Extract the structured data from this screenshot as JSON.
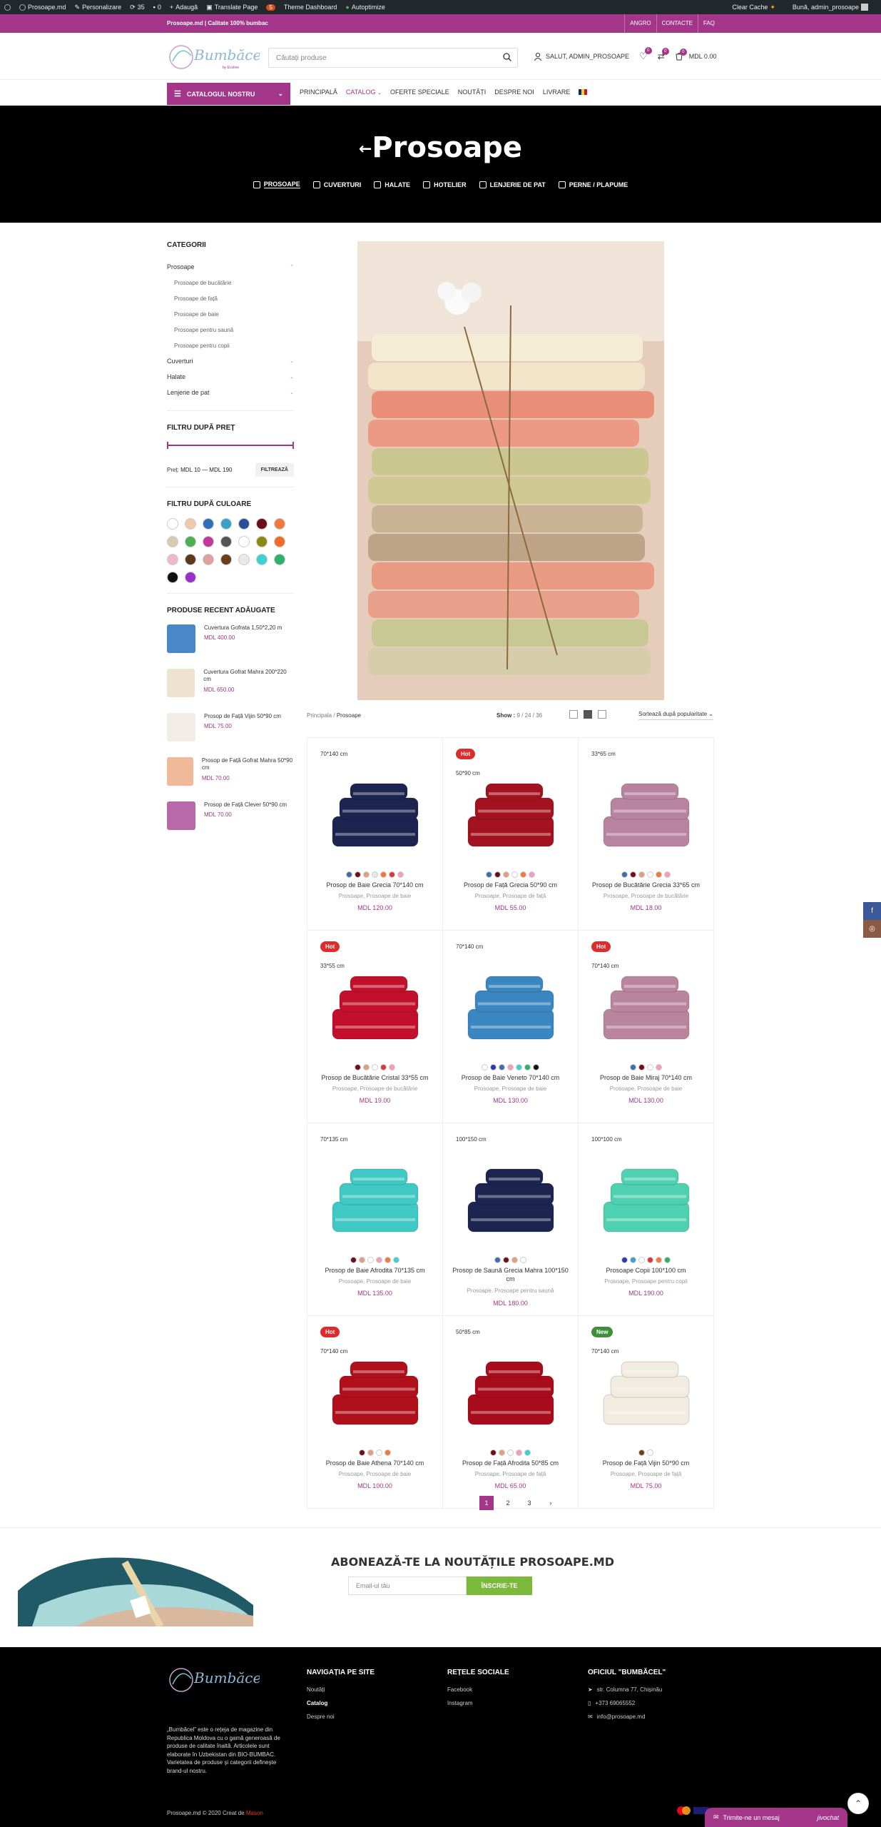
{
  "adminbar": {
    "site": "Prosoape.md",
    "customize": "Personalizare",
    "updates": "35",
    "comments": "0",
    "add": "Adaugă",
    "translate": "Translate Page",
    "badge": "5",
    "theme": "Theme Dashboard",
    "autoptimize": "Autoptimize",
    "clear_cache": "Clear Cache",
    "greeting": "Bună, admin_prosoape"
  },
  "topbar": {
    "text": "Prosoape.md | Calitate 100% bumbac",
    "links": [
      "ANGRO",
      "CONTACTE",
      "FAQ"
    ]
  },
  "header": {
    "logo_text": "Bumbăcel",
    "logo_tag": "by Ecoline",
    "search_placeholder": "Căutați produse",
    "account": "SALUT, ADMIN_PROSOAPE",
    "wishlist_count": "0",
    "compare_count": "0",
    "cart_count": "0",
    "cart_total": "MDL 0.00"
  },
  "nav": {
    "catalog_button": "CATALOGUL NOSTRU",
    "items": [
      "PRINCIPALĂ",
      "CATALOG",
      "OFERTE SPECIALE",
      "NOUTĂȚI",
      "DESPRE NOI",
      "LIVRARE"
    ]
  },
  "hero": {
    "title": "Prosoape",
    "cats": [
      "PROSOAPE",
      "CUVERTURI",
      "HALATE",
      "HOTELIER",
      "LENJERIE DE PAT",
      "PERNE / PLAPUME"
    ]
  },
  "sidebar": {
    "categories_title": "CATEGORII",
    "categories": [
      {
        "label": "Prosoape",
        "sub": false
      },
      {
        "label": "Prosoape de bucătărie",
        "sub": true
      },
      {
        "label": "Prosoape de față",
        "sub": true
      },
      {
        "label": "Prosoape de baie",
        "sub": true
      },
      {
        "label": "Prosoape pentru saună",
        "sub": true
      },
      {
        "label": "Prosoape pentru copii",
        "sub": true
      },
      {
        "label": "Cuverturi",
        "sub": false
      },
      {
        "label": "Halate",
        "sub": false
      },
      {
        "label": "Lenjerie de pat",
        "sub": false
      }
    ],
    "price_title": "FILTRU DUPĂ PREȚ",
    "price_label": "Preț:",
    "price_range": "MDL 10 — MDL 190",
    "price_button": "FILTREAZĂ",
    "color_title": "FILTRU DUPĂ CULOARE",
    "colors": [
      "#ffffff",
      "#f2c9a8",
      "#2f6fb5",
      "#3aa0c8",
      "#2a4e9a",
      "#6b0f1a",
      "#f07a3c",
      "#d8cbb0",
      "#4caf50",
      "#c0399a",
      "#555555",
      "#ffffff",
      "#8a8a14",
      "#f06a2a",
      "#f0b8c8",
      "#5a3a1a",
      "#e0a0a0",
      "#6b3f1a",
      "#e8e8e8",
      "#3fd0d0",
      "#2fb06a",
      "#111111",
      "#9b30c8"
    ],
    "recent_title": "PRODUSE RECENT ADĂUGATE",
    "recent": [
      {
        "name": "Cuvertura Gofrata 1,50*2,20 m",
        "price": "MDL 400.00",
        "color": "#4a86c8"
      },
      {
        "name": "Cuvertura Gofrat Mahra 200*220 cm",
        "price": "MDL 650.00",
        "color": "#efe3cf"
      },
      {
        "name": "Prosop de Față Vijin 50*90 cm",
        "price": "MDL 75.00",
        "color": "#f2ede6"
      },
      {
        "name": "Prosop de Față Gofrat Mahra 50*90 cm",
        "price": "MDL 70.00",
        "color": "#efb99a"
      },
      {
        "name": "Prosop de Față Clever 50*90 cm",
        "price": "MDL 70.00",
        "color": "#b86aa8"
      }
    ]
  },
  "toolbar": {
    "breadcrumb_home": "Principala",
    "breadcrumb_sep": "/",
    "breadcrumb_current": "Prosoape",
    "show_label": "Show :",
    "show_options": [
      "9",
      "24",
      "36"
    ],
    "sort": "Sortează după popularitate"
  },
  "products": [
    {
      "badge": "",
      "size": "70*140 cm",
      "title": "Prosop de Baie Grecia 70*140 cm",
      "cats": "Prosoape, Prosoape de baie",
      "price": "MDL 120.00",
      "color": "#1c2450",
      "colors": [
        "#3a6fa8",
        "#6b0f1a",
        "#e0a080",
        "#e8e8e8",
        "#f07a3c",
        "#d63a3a",
        "#f0a0b8"
      ]
    },
    {
      "badge": "Hot",
      "size": "50*90 cm",
      "title": "Prosop de Față Grecia 50*90 cm",
      "cats": "Prosoape, Prosoape de față",
      "price": "MDL 55.00",
      "color": "#a3131f",
      "colors": [
        "#3a6fa8",
        "#6b0f1a",
        "#e0a080",
        "#ffffff",
        "#f07a3c",
        "#f0a0b8"
      ]
    },
    {
      "badge": "",
      "size": "33*65 cm",
      "title": "Prosop de Bucătărie Grecia 33*65 cm",
      "cats": "Prosoape, Prosoape de bucătărie",
      "price": "MDL 18.00",
      "color": "#b883a0",
      "colors": [
        "#3a6fa8",
        "#6b0f1a",
        "#e0a080",
        "#ffffff",
        "#f07a3c",
        "#f0a0b8"
      ]
    },
    {
      "badge": "Hot",
      "size": "33*55 cm",
      "title": "Prosop de Bucătărie Cristal 33*55 cm",
      "cats": "Prosoape, Prosoape de bucătărie",
      "price": "MDL 19.00",
      "color": "#c2102c",
      "colors": [
        "#6b0f1a",
        "#e0a080",
        "#ffffff",
        "#d63a3a",
        "#f0a0b8"
      ]
    },
    {
      "badge": "",
      "size": "70*140 cm",
      "title": "Prosop de Baie Veneto 70*140 cm",
      "cats": "Prosoape, Prosoape de baie",
      "price": "MDL 130.00",
      "color": "#3a86c0",
      "colors": [
        "#ffffff",
        "#2a3aa8",
        "#3a6fa8",
        "#f0a0b8",
        "#3fd0d0",
        "#2fb06a",
        "#111111"
      ]
    },
    {
      "badge": "Hot",
      "size": "70*140 cm",
      "title": "Prosop de Baie Miraj 70*140 cm",
      "cats": "Prosoape, Prosoape de baie",
      "price": "MDL 130.00",
      "color": "#b9859c",
      "colors": [
        "#3a6fa8",
        "#6b0f1a",
        "#ffffff",
        "#f0a0b8"
      ]
    },
    {
      "badge": "",
      "size": "70*135 cm",
      "title": "Prosop de Baie Afrodita 70*135 cm",
      "cats": "Prosoape, Prosoape de baie",
      "price": "MDL 135.00",
      "color": "#40c8c4",
      "colors": [
        "#6b0f1a",
        "#e0a080",
        "#ffffff",
        "#f0a0b8",
        "#f07a3c",
        "#3fd0d0"
      ]
    },
    {
      "badge": "",
      "size": "100*150 cm",
      "title": "Prosop de Saună Grecia Mahra 100*150 cm",
      "cats": "Prosoape, Prosoape pentru saună",
      "price": "MDL 180.00",
      "color": "#1c2450",
      "colors": [
        "#3a6fa8",
        "#6b0f1a",
        "#e0a080",
        "#ffffff"
      ]
    },
    {
      "badge": "",
      "size": "100*100 cm",
      "title": "Prosoape Copii 100*100 cm",
      "cats": "Prosoape, Prosoape pentru copii",
      "price": "MDL 190.00",
      "color": "#4fd0b0",
      "colors": [
        "#2a3aa8",
        "#3aa0c8",
        "#ffffff",
        "#d63a3a",
        "#f07a3c",
        "#2fb06a"
      ]
    },
    {
      "badge": "Hot",
      "size": "70*140 cm",
      "title": "Prosop de Baie Athena 70*140 cm",
      "cats": "Prosoape, Prosoape de baie",
      "price": "MDL 100.00",
      "color": "#b0101c",
      "colors": [
        "#6b0f1a",
        "#e0a080",
        "#ffffff",
        "#f07a3c"
      ]
    },
    {
      "badge": "",
      "size": "50*85 cm",
      "title": "Prosop de Față Afrodita 50*85 cm",
      "cats": "Prosoape, Prosoape de față",
      "price": "MDL 65.00",
      "color": "#a80c1c",
      "colors": [
        "#6b0f1a",
        "#e0a080",
        "#ffffff",
        "#f0a0b8",
        "#3fd0d0"
      ]
    },
    {
      "badge": "New",
      "size": "70*140 cm",
      "title": "Prosop de Față Vijin 50*90 cm",
      "cats": "Prosoape, Prosoape de față",
      "price": "MDL 75.00",
      "color": "#f1ebe0",
      "colors": [
        "#6b3f1a",
        "#ffffff"
      ]
    }
  ],
  "pagination": [
    "1",
    "2",
    "3",
    "›"
  ],
  "newsletter": {
    "title": "ABONEAZĂ-TE LA NOUTĂȚILE PROSOAPE.MD",
    "placeholder": "Email-ul tău",
    "button": "ÎNSCRIE-TE"
  },
  "footer": {
    "about": "„Bumbăcel” este o rețeja de magazine din Republica Moldova cu o gamă generoasă de produse de calitate înaltă. Articolele sunt elaborate în Uzbekistan din BIO-BUMBAC. Varietatea de produse și categorii definește brand-ul nostru.",
    "nav_title": "NAVIGAȚIA PE SITE",
    "nav_items": [
      "Noutăți",
      "Catalog",
      "Despre noi"
    ],
    "social_title": "REȚELE SOCIALE",
    "social_items": [
      "Facebook",
      "Instagram"
    ],
    "office_title": "OFICIUL \"BUMBĂCEL\"",
    "address": "str. Columna 77, Chișinău",
    "phone": "+373 69065552",
    "email": "info@prosoape.md",
    "copyright": "Prosoape.md © 2020 Creat de",
    "creator": "Mason"
  },
  "chat": {
    "text": "Trimite-ne un mesaj",
    "brand": "jivochat"
  }
}
